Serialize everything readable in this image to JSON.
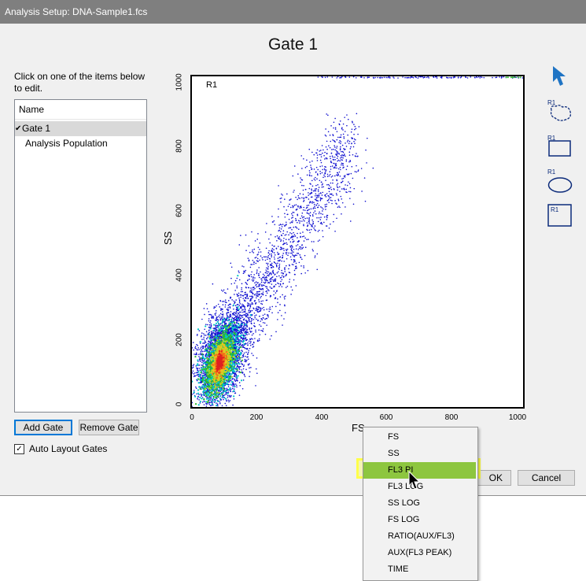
{
  "window": {
    "title": "Analysis Setup:  DNA-Sample1.fcs"
  },
  "gate_title": "Gate 1",
  "instructions": "Click on one of the items below to edit.",
  "list": {
    "header": "Name",
    "items": [
      {
        "label": "Gate 1",
        "checked": true,
        "selected": true
      },
      {
        "label": "Analysis Population",
        "checked": false,
        "selected": false
      }
    ]
  },
  "buttons": {
    "add_gate": "Add Gate",
    "remove_gate": "Remove Gate",
    "ok": "OK",
    "cancel": "Cancel"
  },
  "auto_layout": {
    "label": "Auto Layout Gates",
    "checked": true
  },
  "plot": {
    "region_label": "R1",
    "xlabel": "FS",
    "ylabel": "SS",
    "xticks": [
      "0",
      "200",
      "400",
      "600",
      "800",
      "1000"
    ],
    "yticks": [
      "0",
      "200",
      "400",
      "600",
      "800",
      "1000"
    ],
    "range": [
      0,
      1000
    ]
  },
  "tools": {
    "icons": [
      "pointer-icon",
      "freeform-region-icon",
      "rectangle-region-icon",
      "ellipse-region-icon",
      "quadrant-region-icon"
    ],
    "labels": [
      "R1",
      "R1",
      "R1",
      "R1"
    ],
    "color": "#0b2a7a"
  },
  "dropdown": {
    "items": [
      "FS",
      "SS",
      "FL3 PI",
      "FL3 LOG",
      "SS LOG",
      "FS LOG",
      "RATIO(AUX/FL3)",
      "AUX(FL3 PEAK)",
      "TIME"
    ],
    "highlighted": "FL3 PI",
    "highlight_color": "#8dc63f"
  }
}
